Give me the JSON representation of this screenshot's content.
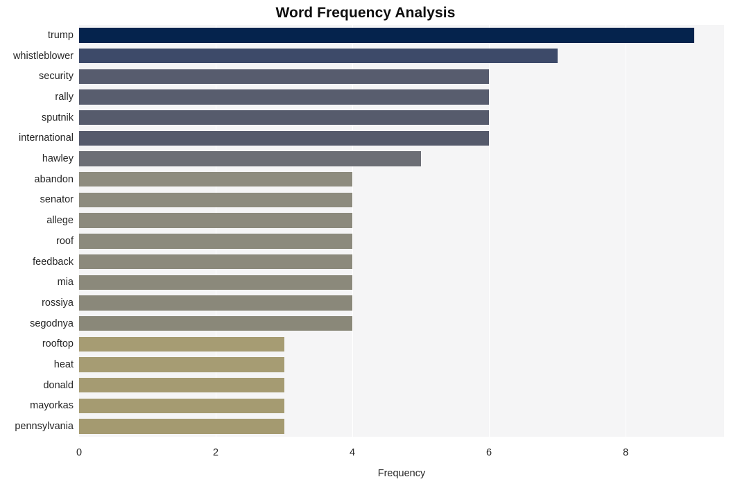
{
  "chart_data": {
    "type": "bar",
    "orientation": "horizontal",
    "title": "Word Frequency Analysis",
    "xlabel": "Frequency",
    "ylabel": "",
    "xlim": [
      0,
      9.44
    ],
    "xticks": [
      0,
      2,
      4,
      6,
      8
    ],
    "xtick_labels": [
      "0",
      "2",
      "4",
      "6",
      "8"
    ],
    "grid": "vertical",
    "legend": "none",
    "categories": [
      "trump",
      "whistleblower",
      "security",
      "rally",
      "sputnik",
      "international",
      "hawley",
      "abandon",
      "senator",
      "allege",
      "roof",
      "feedback",
      "mia",
      "rossiya",
      "segodnya",
      "rooftop",
      "heat",
      "donald",
      "mayorkas",
      "pennsylvania"
    ],
    "values": [
      9,
      7,
      6,
      6,
      6,
      6,
      5,
      4,
      4,
      4,
      4,
      4,
      4,
      4,
      4,
      3,
      3,
      3,
      3,
      3
    ],
    "bar_colors": [
      "#05234d",
      "#3d4a69",
      "#575c6e",
      "#585d6e",
      "#565b6c",
      "#555a6b",
      "#6c6e75",
      "#8d8b7e",
      "#8d8b7e",
      "#8c8a7d",
      "#8c8a7d",
      "#8c8a7c",
      "#8b897b",
      "#8a887a",
      "#8a8879",
      "#a69c73",
      "#a69c73",
      "#a59b72",
      "#a59b71",
      "#a49a70"
    ],
    "colors": {
      "plot_background": "#f5f5f6",
      "figure_background": "#ffffff",
      "gridline": "#ffffff",
      "text": "#262626",
      "title": "#0d0d0d"
    }
  }
}
